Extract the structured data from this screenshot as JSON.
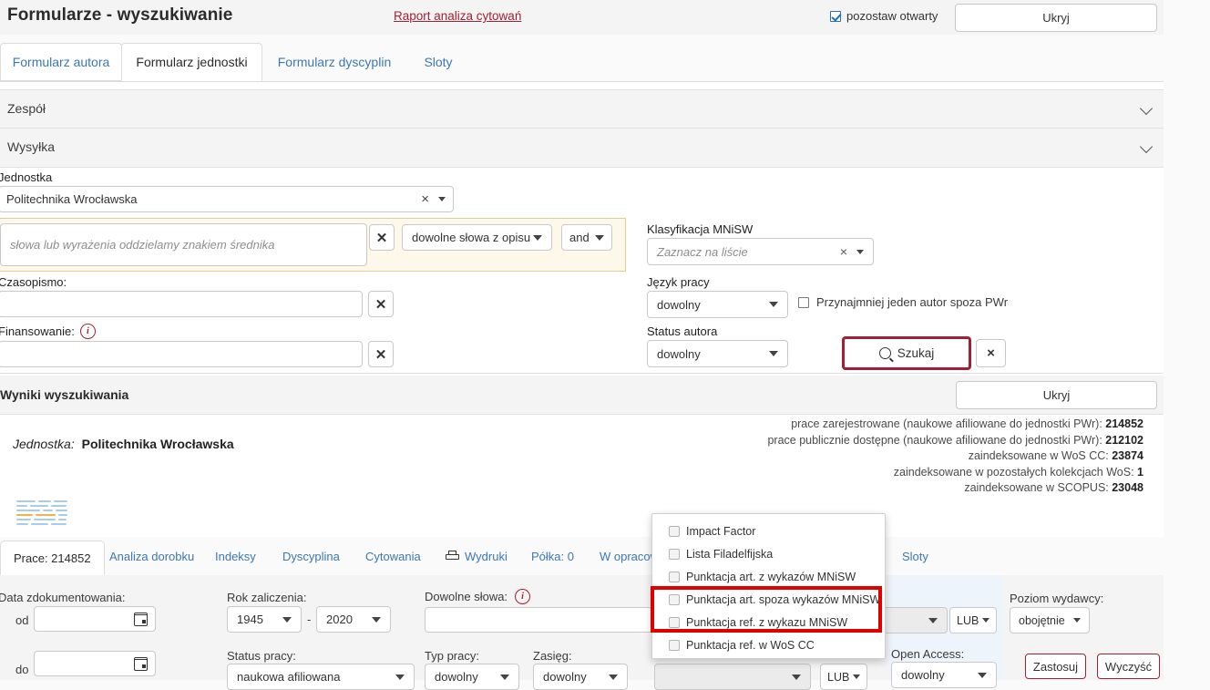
{
  "header": {
    "title": "Formularze - wyszukiwanie",
    "report_link": "Raport analiza cytowań",
    "keep_open_label": "pozostaw otwarty",
    "hide_button": "Ukryj"
  },
  "tabs": [
    {
      "label": "Formularz autora",
      "active": false
    },
    {
      "label": "Formularz jednostki",
      "active": true
    },
    {
      "label": "Formularz dyscyplin",
      "active": false
    },
    {
      "label": "Sloty",
      "active": false
    }
  ],
  "accordions": [
    {
      "label": "Zespół"
    },
    {
      "label": "Wysyłka"
    }
  ],
  "form": {
    "unit_label": "Jednostka",
    "unit_value": "Politechnika Wrocławska",
    "words_placeholder": "słowa lub wyrażenia oddzielamy znakiem średnika",
    "words_scope": "dowolne słowa z opisu",
    "words_operator": "and",
    "journal_label": "Czasopismo:",
    "journal_value": "",
    "funding_label": "Finansowanie:",
    "funding_value": "",
    "classification_label": "Klasyfikacja MNiSW",
    "classification_placeholder": "Zaznacz na liście",
    "language_label": "Język pracy",
    "language_value": "dowolny",
    "external_author_label": "Przynajmniej jeden autor spoza PWr",
    "author_status_label": "Status autora",
    "author_status_value": "dowolny",
    "search_button": "Szukaj",
    "clear_button": "×"
  },
  "results": {
    "header": "Wyniki wyszukiwania",
    "hide_button": "Ukryj",
    "unit_label": "Jednostka:",
    "unit_name": "Politechnika Wrocławska",
    "stats": [
      {
        "label": "prace zarejestrowane (naukowe afiliowane do jednostki PWr):",
        "value": "214852"
      },
      {
        "label": "prace publicznie dostępne (naukowe afiliowane do jednostki PWr):",
        "value": "212102"
      },
      {
        "label": "zaindeksowane w WoS CC:",
        "value": "23874"
      },
      {
        "label": "zaindeksowane w pozostałych kolekcjach WoS:",
        "value": "1"
      },
      {
        "label": "zaindeksowane w SCOPUS:",
        "value": "23048"
      }
    ]
  },
  "result_tabs": [
    {
      "label": "Prace: 214852",
      "active": true,
      "icon": ""
    },
    {
      "label": "Analiza dorobku",
      "active": false,
      "icon": ""
    },
    {
      "label": "Indeksy",
      "active": false,
      "icon": ""
    },
    {
      "label": "Dyscyplina",
      "active": false,
      "icon": ""
    },
    {
      "label": "Cytowania",
      "active": false,
      "icon": ""
    },
    {
      "label": "Wydruki",
      "active": false,
      "icon": "printer-icon"
    },
    {
      "label": "Półka: 0",
      "active": false,
      "icon": ""
    },
    {
      "label": "W opracowaniu",
      "active": false,
      "icon": ""
    },
    {
      "label": "Sloty",
      "active": false,
      "icon": ""
    }
  ],
  "dropdown": {
    "items": [
      {
        "label": "Impact Factor",
        "checked": false
      },
      {
        "label": "Lista Filadelfijska",
        "checked": false
      },
      {
        "label": "Punktacja art. z wykazów MNiSW",
        "checked": false
      },
      {
        "label": "Punktacja art. spoza wykazów MNiSW",
        "checked": false
      },
      {
        "label": "Punktacja ref. z wykazu MNiSW",
        "checked": false
      },
      {
        "label": "Punktacja ref. w WoS CC",
        "checked": false
      }
    ]
  },
  "bottom_filters": {
    "doc_date_label": "Data zdokumentowania:",
    "from_label": "od",
    "from_value": "",
    "to_label": "do",
    "to_value": "",
    "year_label": "Rok zaliczenia:",
    "year_from": "1945",
    "year_to": "2020",
    "year_sep": "-",
    "work_status_label": "Status pracy:",
    "work_status_value": "naukowa afiliowana",
    "any_words_label": "Dowolne słowa:",
    "any_words_value": "",
    "work_type_label": "Typ pracy:",
    "work_type_value": "dowolny",
    "scope_label": "Zasięg:",
    "scope_value": "dowolny",
    "points_value": "",
    "lub_1": "LUB",
    "lub_2": "LUB",
    "publisher_level_label": "Poziom wydawcy:",
    "publisher_level_value": "obojętnie",
    "open_access_label": "Open Access:",
    "open_access_value": "dowolny",
    "apply_button": "Zastosuj",
    "clear_button": "Wyczyść"
  },
  "colors": {
    "accent_red": "#a31f34",
    "link_blue": "#3b78b5",
    "highlight_red": "#e00000",
    "panel_yellow": "#fdf8e9"
  }
}
